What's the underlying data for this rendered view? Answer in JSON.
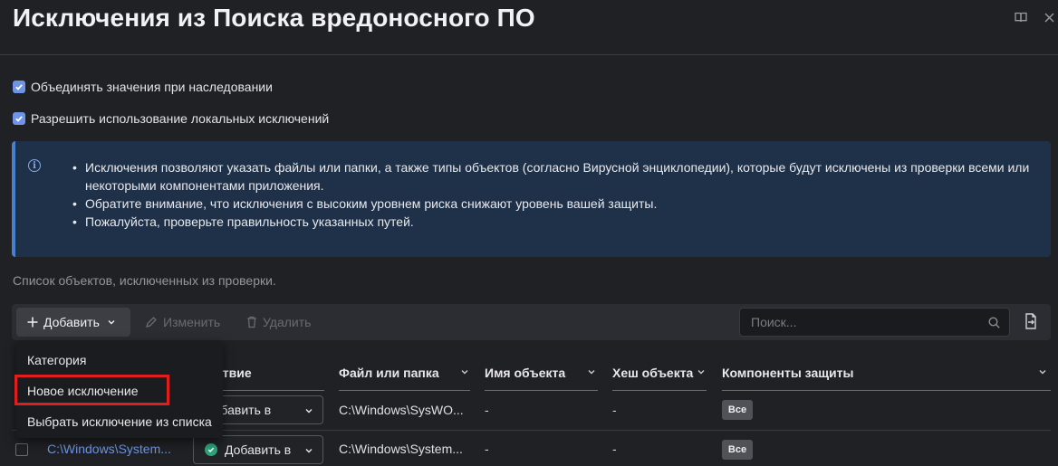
{
  "header": {
    "title": "Исключения из Поиска вредоносного ПО",
    "icons": [
      "book-icon",
      "close-icon"
    ]
  },
  "settings": {
    "merge_values": {
      "label": "Объединять значения при наследовании",
      "checked": true
    },
    "allow_local": {
      "label": "Разрешить использование локальных исключений",
      "checked": true
    }
  },
  "info": {
    "icon": "info-icon",
    "items": [
      "Исключения позволяют указать файлы или папки, а также типы объектов (согласно Вирусной энциклопедии), которые будут исключены из проверки всеми или некоторыми компонентами приложения.",
      "Обратите внимание, что исключения с высоким уровнем риска снижают уровень вашей защиты.",
      "Пожалуйста, проверьте правильность указанных путей."
    ]
  },
  "list_caption": "Список объектов, исключенных из проверки.",
  "toolbar": {
    "add_label": "Добавить",
    "edit_label": "Изменить",
    "delete_label": "Удалить",
    "search_placeholder": "Поиск..."
  },
  "dropdown": {
    "items": [
      "Категория",
      "Новое исключение",
      "Выбрать исключение из списка"
    ],
    "highlighted": "Новое исключение"
  },
  "table": {
    "columns": {
      "action": "ствие",
      "path": "Файл или папка",
      "object_name": "Имя объекта",
      "hash": "Хеш объекта",
      "components": "Компоненты защиты"
    },
    "rows": [
      {
        "name": "",
        "action": "Добавить в",
        "path": "C:\\Windows\\SysWO...",
        "object_name": "-",
        "hash": "-",
        "components": "Все"
      },
      {
        "name": "C:\\Windows\\System...",
        "action": "Добавить в",
        "path": "C:\\Windows\\System...",
        "object_name": "-",
        "hash": "-",
        "components": "Все"
      }
    ]
  },
  "colors": {
    "background": "#202125",
    "accent": "#6f93e6",
    "info_bg": "#1e3148",
    "highlight": "#e01e1e",
    "success": "#2fa37a"
  }
}
